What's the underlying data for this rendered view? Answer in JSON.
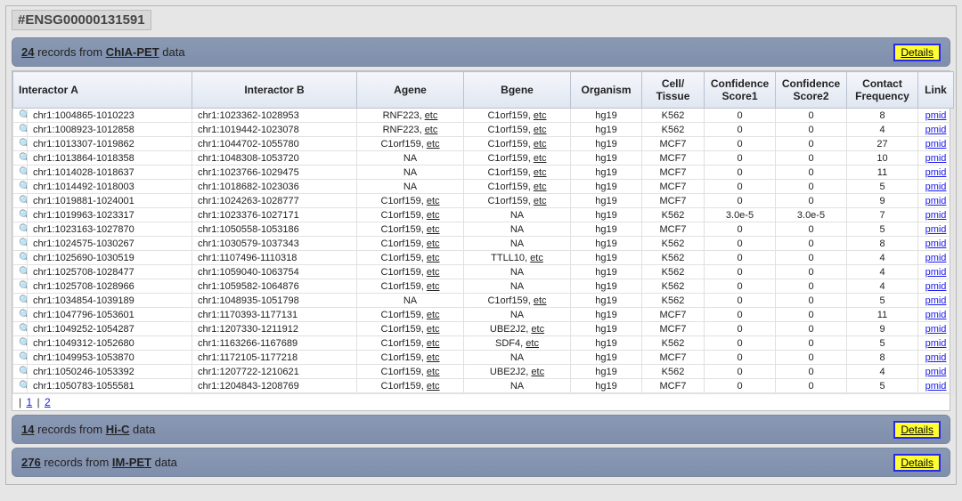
{
  "page_title": "#ENSG00000131591",
  "details_label": "Details",
  "pager": {
    "pages": [
      "1",
      "2"
    ]
  },
  "sections": {
    "chia": {
      "count": "24",
      "prefix": "records from",
      "source": "ChIA-PET",
      "suffix": "data"
    },
    "hic": {
      "count": "14",
      "prefix": "records from",
      "source": "Hi-C",
      "suffix": "data"
    },
    "impet": {
      "count": "276",
      "prefix": "records from",
      "source": "IM-PET",
      "suffix": "data"
    }
  },
  "headers": {
    "intA": "Interactor A",
    "intB": "Interactor B",
    "agene": "Agene",
    "bgene": "Bgene",
    "org": "Organism",
    "cell": "Cell/\nTissue",
    "conf1": "Confidence\nScore1",
    "conf2": "Confidence\nScore2",
    "freq": "Contact\nFrequency",
    "link": "Link"
  },
  "link_label": "pmid",
  "etc_label": "etc",
  "rows": [
    {
      "intA": "chr1:1004865-1010223",
      "intB": "chr1:1023362-1028953",
      "agene": "RNF223",
      "agene_etc": true,
      "bgene": "C1orf159",
      "bgene_etc": true,
      "org": "hg19",
      "cell": "K562",
      "c1": "0",
      "c2": "0",
      "freq": "8"
    },
    {
      "intA": "chr1:1008923-1012858",
      "intB": "chr1:1019442-1023078",
      "agene": "RNF223",
      "agene_etc": true,
      "bgene": "C1orf159",
      "bgene_etc": true,
      "org": "hg19",
      "cell": "K562",
      "c1": "0",
      "c2": "0",
      "freq": "4"
    },
    {
      "intA": "chr1:1013307-1019862",
      "intB": "chr1:1044702-1055780",
      "agene": "C1orf159",
      "agene_etc": true,
      "bgene": "C1orf159",
      "bgene_etc": true,
      "org": "hg19",
      "cell": "MCF7",
      "c1": "0",
      "c2": "0",
      "freq": "27"
    },
    {
      "intA": "chr1:1013864-1018358",
      "intB": "chr1:1048308-1053720",
      "agene": "NA",
      "agene_etc": false,
      "bgene": "C1orf159",
      "bgene_etc": true,
      "org": "hg19",
      "cell": "MCF7",
      "c1": "0",
      "c2": "0",
      "freq": "10"
    },
    {
      "intA": "chr1:1014028-1018637",
      "intB": "chr1:1023766-1029475",
      "agene": "NA",
      "agene_etc": false,
      "bgene": "C1orf159",
      "bgene_etc": true,
      "org": "hg19",
      "cell": "MCF7",
      "c1": "0",
      "c2": "0",
      "freq": "11"
    },
    {
      "intA": "chr1:1014492-1018003",
      "intB": "chr1:1018682-1023036",
      "agene": "NA",
      "agene_etc": false,
      "bgene": "C1orf159",
      "bgene_etc": true,
      "org": "hg19",
      "cell": "MCF7",
      "c1": "0",
      "c2": "0",
      "freq": "5"
    },
    {
      "intA": "chr1:1019881-1024001",
      "intB": "chr1:1024263-1028777",
      "agene": "C1orf159",
      "agene_etc": true,
      "bgene": "C1orf159",
      "bgene_etc": true,
      "org": "hg19",
      "cell": "MCF7",
      "c1": "0",
      "c2": "0",
      "freq": "9"
    },
    {
      "intA": "chr1:1019963-1023317",
      "intB": "chr1:1023376-1027171",
      "agene": "C1orf159",
      "agene_etc": true,
      "bgene": "NA",
      "bgene_etc": false,
      "org": "hg19",
      "cell": "K562",
      "c1": "3.0e-5",
      "c2": "3.0e-5",
      "freq": "7"
    },
    {
      "intA": "chr1:1023163-1027870",
      "intB": "chr1:1050558-1053186",
      "agene": "C1orf159",
      "agene_etc": true,
      "bgene": "NA",
      "bgene_etc": false,
      "org": "hg19",
      "cell": "MCF7",
      "c1": "0",
      "c2": "0",
      "freq": "5"
    },
    {
      "intA": "chr1:1024575-1030267",
      "intB": "chr1:1030579-1037343",
      "agene": "C1orf159",
      "agene_etc": true,
      "bgene": "NA",
      "bgene_etc": false,
      "org": "hg19",
      "cell": "K562",
      "c1": "0",
      "c2": "0",
      "freq": "8"
    },
    {
      "intA": "chr1:1025690-1030519",
      "intB": "chr1:1107496-1110318",
      "agene": "C1orf159",
      "agene_etc": true,
      "bgene": "TTLL10",
      "bgene_etc": true,
      "org": "hg19",
      "cell": "K562",
      "c1": "0",
      "c2": "0",
      "freq": "4"
    },
    {
      "intA": "chr1:1025708-1028477",
      "intB": "chr1:1059040-1063754",
      "agene": "C1orf159",
      "agene_etc": true,
      "bgene": "NA",
      "bgene_etc": false,
      "org": "hg19",
      "cell": "K562",
      "c1": "0",
      "c2": "0",
      "freq": "4"
    },
    {
      "intA": "chr1:1025708-1028966",
      "intB": "chr1:1059582-1064876",
      "agene": "C1orf159",
      "agene_etc": true,
      "bgene": "NA",
      "bgene_etc": false,
      "org": "hg19",
      "cell": "K562",
      "c1": "0",
      "c2": "0",
      "freq": "4"
    },
    {
      "intA": "chr1:1034854-1039189",
      "intB": "chr1:1048935-1051798",
      "agene": "NA",
      "agene_etc": false,
      "bgene": "C1orf159",
      "bgene_etc": true,
      "org": "hg19",
      "cell": "K562",
      "c1": "0",
      "c2": "0",
      "freq": "5"
    },
    {
      "intA": "chr1:1047796-1053601",
      "intB": "chr1:1170393-1177131",
      "agene": "C1orf159",
      "agene_etc": true,
      "bgene": "NA",
      "bgene_etc": false,
      "org": "hg19",
      "cell": "MCF7",
      "c1": "0",
      "c2": "0",
      "freq": "11"
    },
    {
      "intA": "chr1:1049252-1054287",
      "intB": "chr1:1207330-1211912",
      "agene": "C1orf159",
      "agene_etc": true,
      "bgene": "UBE2J2",
      "bgene_etc": true,
      "org": "hg19",
      "cell": "MCF7",
      "c1": "0",
      "c2": "0",
      "freq": "9"
    },
    {
      "intA": "chr1:1049312-1052680",
      "intB": "chr1:1163266-1167689",
      "agene": "C1orf159",
      "agene_etc": true,
      "bgene": "SDF4",
      "bgene_etc": true,
      "org": "hg19",
      "cell": "K562",
      "c1": "0",
      "c2": "0",
      "freq": "5"
    },
    {
      "intA": "chr1:1049953-1053870",
      "intB": "chr1:1172105-1177218",
      "agene": "C1orf159",
      "agene_etc": true,
      "bgene": "NA",
      "bgene_etc": false,
      "org": "hg19",
      "cell": "MCF7",
      "c1": "0",
      "c2": "0",
      "freq": "8"
    },
    {
      "intA": "chr1:1050246-1053392",
      "intB": "chr1:1207722-1210621",
      "agene": "C1orf159",
      "agene_etc": true,
      "bgene": "UBE2J2",
      "bgene_etc": true,
      "org": "hg19",
      "cell": "K562",
      "c1": "0",
      "c2": "0",
      "freq": "4"
    },
    {
      "intA": "chr1:1050783-1055581",
      "intB": "chr1:1204843-1208769",
      "agene": "C1orf159",
      "agene_etc": true,
      "bgene": "NA",
      "bgene_etc": false,
      "org": "hg19",
      "cell": "MCF7",
      "c1": "0",
      "c2": "0",
      "freq": "5"
    }
  ]
}
